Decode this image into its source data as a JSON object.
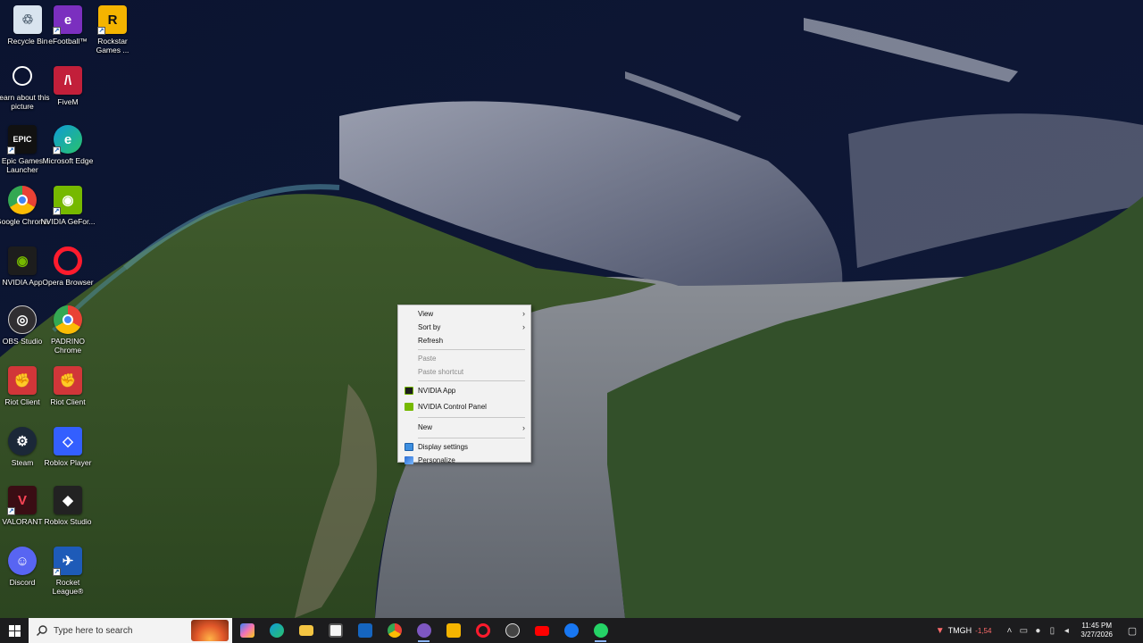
{
  "desktop": {
    "icons": [
      {
        "label": "Recycle Bin",
        "icon": "recycle-bin-icon",
        "color": "#d9e4ef"
      },
      {
        "label": "eFootball™",
        "icon": "efootball-icon",
        "color": "#7b2fbf"
      },
      {
        "label": "Rockstar Games ...",
        "icon": "rockstar-icon",
        "color": "#f4b400"
      },
      {
        "label": "Learn about this picture",
        "icon": "learn-picture-icon",
        "color": "#ffffff"
      },
      {
        "label": "FiveM",
        "icon": "fivem-icon",
        "color": "#c21f3a"
      },
      {
        "label": "Epic Games Launcher",
        "icon": "epic-games-icon",
        "color": "#111111"
      },
      {
        "label": "Microsoft Edge",
        "icon": "edge-icon",
        "color": "#0f9bd7"
      },
      {
        "label": "Google Chrome",
        "icon": "chrome-icon",
        "color": "#e94235"
      },
      {
        "label": "NVIDIA GeFor...",
        "icon": "nvidia-geforce-icon",
        "color": "#76b900"
      },
      {
        "label": "NVIDIA App",
        "icon": "nvidia-app-icon",
        "color": "#76b900"
      },
      {
        "label": "Opera Browser",
        "icon": "opera-icon",
        "color": "#ff1b2d"
      },
      {
        "label": "OBS Studio",
        "icon": "obs-icon",
        "color": "#302e31"
      },
      {
        "label": "PADRINO Chrome",
        "icon": "chrome-profile-icon",
        "color": "#e94235"
      },
      {
        "label": "Riot Client",
        "icon": "riot-client-icon",
        "color": "#d13639"
      },
      {
        "label": "Riot Client",
        "icon": "riot-client-icon",
        "color": "#d13639"
      },
      {
        "label": "Steam",
        "icon": "steam-icon",
        "color": "#1b2838"
      },
      {
        "label": "Roblox Player",
        "icon": "roblox-player-icon",
        "color": "#335fff"
      },
      {
        "label": "VALORANT",
        "icon": "valorant-icon",
        "color": "#fd4556"
      },
      {
        "label": "Roblox Studio",
        "icon": "roblox-studio-icon",
        "color": "#222222"
      },
      {
        "label": "Discord",
        "icon": "discord-icon",
        "color": "#5865f2"
      },
      {
        "label": "Rocket League®",
        "icon": "rocket-league-icon",
        "color": "#1e5bb8"
      }
    ]
  },
  "context_menu": {
    "view": "View",
    "sort_by": "Sort by",
    "refresh": "Refresh",
    "paste": "Paste",
    "paste_shortcut": "Paste shortcut",
    "nvidia_app": "NVIDIA App",
    "nvidia_control_panel": "NVIDIA Control Panel",
    "new": "New",
    "display_settings": "Display settings",
    "personalize": "Personalize"
  },
  "taskbar": {
    "search_placeholder": "Type here to search",
    "apps": [
      {
        "icon": "copilot-icon",
        "color": "#3b82f6"
      },
      {
        "icon": "edge-icon",
        "color": "#0f9bd7"
      },
      {
        "icon": "file-explorer-icon",
        "color": "#f4c542"
      },
      {
        "icon": "microsoft-store-icon",
        "color": "#f5f5f5"
      },
      {
        "icon": "mail-icon",
        "color": "#1565c0"
      },
      {
        "icon": "chrome-icon",
        "color": "#e94235"
      },
      {
        "icon": "chrome-profile-icon",
        "color": "#7e57c2"
      },
      {
        "icon": "rockstar-icon",
        "color": "#f4b400"
      },
      {
        "icon": "opera-icon",
        "color": "#ff1b2d"
      },
      {
        "icon": "obs-icon",
        "color": "#444444"
      },
      {
        "icon": "youtube-icon",
        "color": "#ff0000"
      },
      {
        "icon": "facebook-icon",
        "color": "#1877f2"
      },
      {
        "icon": "whatsapp-icon",
        "color": "#25d366"
      }
    ],
    "stock_name": "TMGH",
    "stock_change": "-1,54",
    "time": "11:45 PM",
    "date": "3/27/2026"
  }
}
